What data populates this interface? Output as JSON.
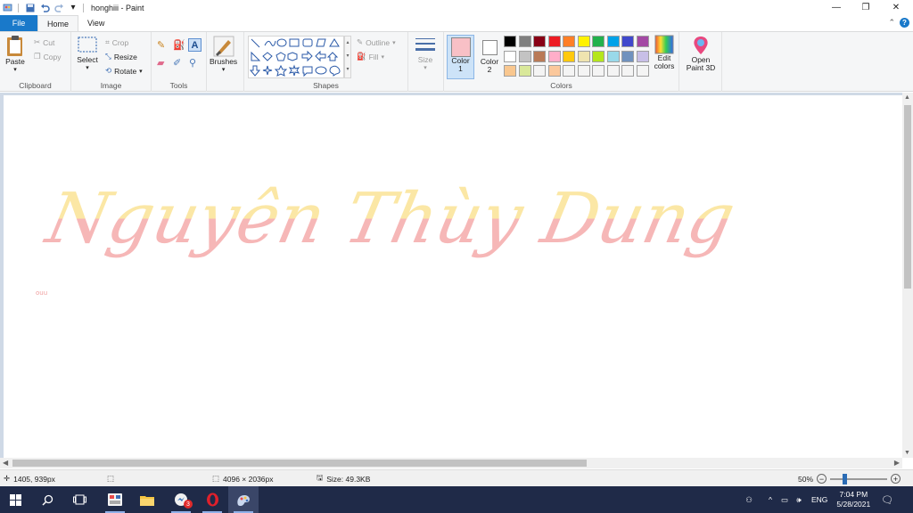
{
  "window": {
    "title": "honghiii - Paint"
  },
  "tabs": {
    "file": "File",
    "home": "Home",
    "view": "View"
  },
  "clipboard": {
    "paste": "Paste",
    "cut": "Cut",
    "copy": "Copy",
    "label": "Clipboard"
  },
  "image": {
    "select": "Select",
    "crop": "Crop",
    "resize": "Resize",
    "rotate": "Rotate",
    "label": "Image"
  },
  "tools": {
    "label": "Tools"
  },
  "brushes": {
    "label": "Brushes"
  },
  "shapes": {
    "outline": "Outline",
    "fill": "Fill",
    "label": "Shapes"
  },
  "size": {
    "label": "Size"
  },
  "colors": {
    "color1": "Color",
    "color1_num": "1",
    "color2": "Color",
    "color2_num": "2",
    "edit": "Edit colors",
    "label": "Colors",
    "color1_value": "#f8c0c6",
    "color2_value": "#ffffff",
    "palette_row1": [
      "#000000",
      "#7f7f7f",
      "#880015",
      "#ed1c24",
      "#ff7f27",
      "#fff200",
      "#22b14c",
      "#00a2e8",
      "#3f48cc",
      "#a349a4"
    ],
    "palette_row2": [
      "#ffffff",
      "#c3c3c3",
      "#b97a57",
      "#ffaec9",
      "#ffc90e",
      "#efe4b0",
      "#b5e61d",
      "#99d9ea",
      "#7092be",
      "#c8bfe7"
    ],
    "palette_row3": [
      "#f9c78f",
      "#d9e89a",
      "#f4f4f4",
      "#fbc89c",
      "#f4f4f4",
      "#f4f4f4",
      "#f4f4f4",
      "#f4f4f4",
      "#f4f4f4",
      "#f4f4f4"
    ]
  },
  "paint3d": {
    "label": "Open Paint 3D"
  },
  "canvas": {
    "artwork_text": "Nguyên Thùy Dung",
    "small_text": "ouu"
  },
  "status": {
    "cursor_pos": "1405, 939px",
    "dimensions": "4096 × 2036px",
    "size": "Size: 49.3KB",
    "zoom": "50%"
  },
  "taskbar": {
    "time": "7:04 PM",
    "date": "5/28/2021",
    "lang": "ENG",
    "badge": "3"
  }
}
